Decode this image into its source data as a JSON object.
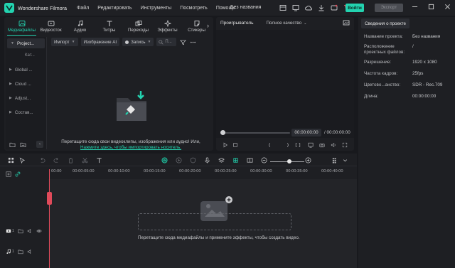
{
  "app": {
    "name": "Wondershare Filmora",
    "project_title": "Без названия"
  },
  "menu": [
    "Файл",
    "Редактировать",
    "Инструменты",
    "Посмотреть",
    "Помощь"
  ],
  "titlebar": {
    "login_label": "Войти",
    "export_label": "Экспорт",
    "accent_color": "#23d3b0"
  },
  "media_tabs": [
    {
      "label": "Медиафайлы",
      "icon": "media-icon",
      "active": true
    },
    {
      "label": "Видеосток",
      "icon": "stock-video-icon"
    },
    {
      "label": "Аудио",
      "icon": "music-note-icon"
    },
    {
      "label": "Титры",
      "icon": "titles-icon"
    },
    {
      "label": "Переходы",
      "icon": "transitions-icon"
    },
    {
      "label": "Эффекты",
      "icon": "effects-icon"
    },
    {
      "label": "Стикеры",
      "icon": "stickers-icon"
    }
  ],
  "sidebar": {
    "items": [
      {
        "label": "Project...",
        "active": true
      },
      {
        "label": "Кат...",
        "sub": true
      },
      {
        "label": "Global ..."
      },
      {
        "label": "Cloud ..."
      },
      {
        "label": "Adjust..."
      },
      {
        "label": "Состав..."
      }
    ]
  },
  "media_toolbar": {
    "import_label": "Импорт",
    "ai_image_label": "Изображение AI",
    "record_label": "Запись",
    "search_placeholder": "П..."
  },
  "import_area": {
    "hint": "Перетащите сюда свои видеоклипы, изображения или аудио! Или,",
    "link": "Нажмите здесь, чтобы импортировать носитель."
  },
  "player": {
    "title": "Проигрыватель",
    "quality": "Полное качество",
    "current_time": "00:00:00:00",
    "total_time": "/ 00:00:00:00"
  },
  "info_panel": {
    "tab": "Сведения о проекте",
    "rows": [
      {
        "key": "Название проекта:",
        "value": "Без названия"
      },
      {
        "key": "Расположение проектных файлов:",
        "value": "/"
      },
      {
        "key": "Разрешение:",
        "value": "1920 x 1080"
      },
      {
        "key": "Частота кадров:",
        "value": "25fps"
      },
      {
        "key": "Цветово...анство:",
        "value": "SDR - Rec.709"
      },
      {
        "key": "Длина:",
        "value": "00:00:00:00"
      }
    ]
  },
  "timeline": {
    "ruler_ticks": [
      "00:00",
      "00:00:05:00",
      "00:00:10:00",
      "00:00:15:00",
      "00:00:20:00",
      "00:00:25:00",
      "00:00:30:00",
      "00:00:35:00",
      "00:00:40:00"
    ],
    "drop_hint": "Перетащите сюда медиафайлы и примените эффекты, чтобы создать видео.",
    "video_track_num": "1",
    "audio_track_num": "1",
    "playhead_color": "#e04a5a"
  }
}
